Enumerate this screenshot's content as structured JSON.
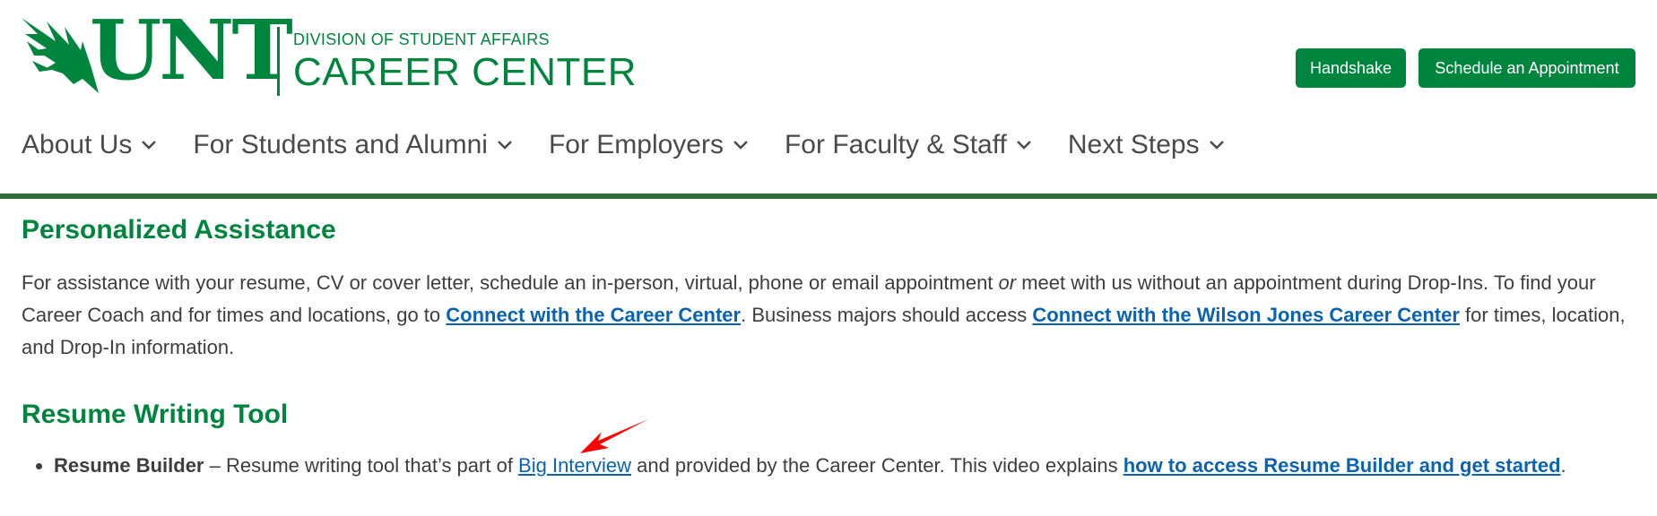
{
  "header": {
    "wordmark": "UNT",
    "division": "DIVISION OF STUDENT AFFAIRS",
    "center": "CAREER CENTER",
    "buttons": {
      "handshake": "Handshake",
      "appointment": "Schedule an Appointment"
    }
  },
  "nav": [
    {
      "label": "About Us"
    },
    {
      "label": "For Students and Alumni"
    },
    {
      "label": "For Employers"
    },
    {
      "label": "For Faculty & Staff"
    },
    {
      "label": "Next Steps"
    }
  ],
  "sections": {
    "assistance": {
      "title": "Personalized Assistance",
      "text1": "For assistance with your resume, CV or cover letter, schedule an in-person, virtual, phone or email appointment ",
      "emph": "or",
      "text2": " meet with us without an appointment during Drop-Ins. To find your Career Coach and for times and locations, go to ",
      "link1": "Connect with the Career Center",
      "text3": ". Business majors should access ",
      "link2": "Connect with the Wilson Jones Career Center",
      "text4": " for times, location, and Drop-In information."
    },
    "resume": {
      "title": "Resume Writing Tool",
      "item_bold": "Resume Builder",
      "item_text1": " – Resume writing tool that’s part of ",
      "item_link1": "Big Interview",
      "item_text2": " and provided by the Career Center. This video explains ",
      "item_link2": "how to access Resume Builder and get started",
      "item_text3": "."
    }
  },
  "colors": {
    "brand_green": "#00853e",
    "link_blue": "#0b63b0",
    "annotation_red": "#ff0000"
  }
}
